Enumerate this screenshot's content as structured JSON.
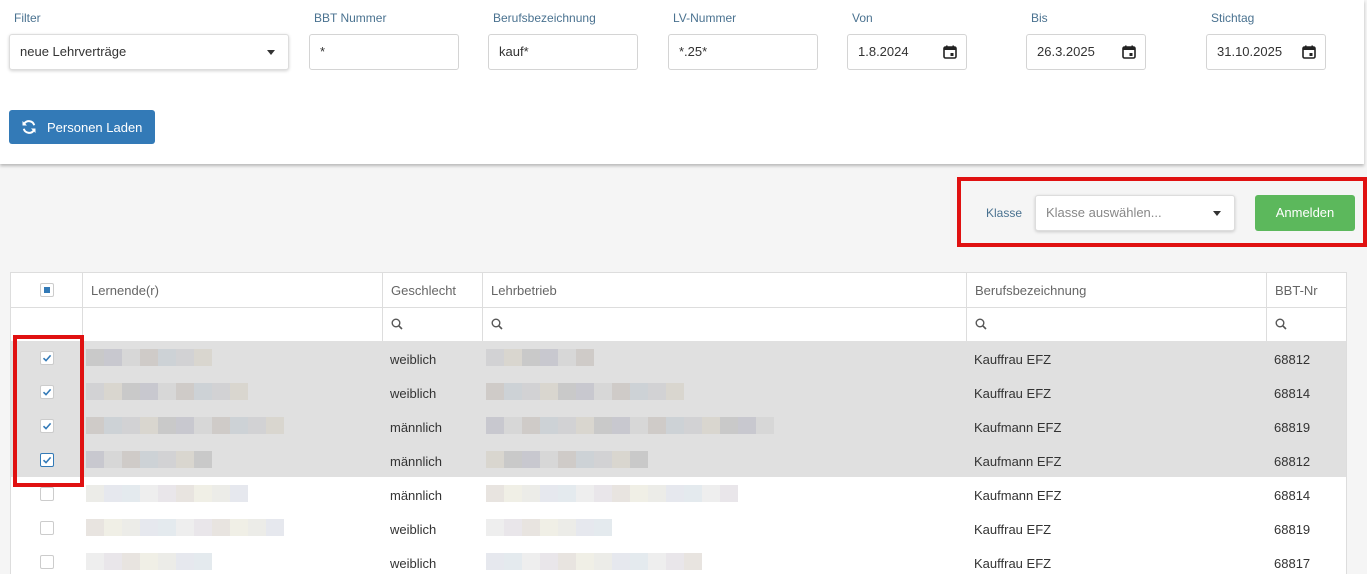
{
  "filters": {
    "filter": {
      "label": "Filter",
      "value": "neue Lehrverträge"
    },
    "bbt": {
      "label": "BBT Nummer",
      "value": "*"
    },
    "beruf": {
      "label": "Berufsbezeichnung",
      "value": "kauf*"
    },
    "lv": {
      "label": "LV-Nummer",
      "value": "*.25*"
    },
    "von": {
      "label": "Von",
      "value": "1.8.2024"
    },
    "bis": {
      "label": "Bis",
      "value": "26.3.2025"
    },
    "stichtag": {
      "label": "Stichtag",
      "value": "31.10.2025"
    },
    "load_button": "Personen Laden"
  },
  "toolbar": {
    "klasse_label": "Klasse",
    "klasse_placeholder": "Klasse auswählen...",
    "anmelden_button": "Anmelden"
  },
  "table": {
    "columns": [
      "Lernende(r)",
      "Geschlecht",
      "Lehrbetrieb",
      "Berufsbezeichnung",
      "BBT-Nr"
    ],
    "rows": [
      {
        "selected": true,
        "geschlecht": "weiblich",
        "beruf": "Kauffrau EFZ",
        "bbt": "68812"
      },
      {
        "selected": true,
        "geschlecht": "weiblich",
        "beruf": "Kauffrau EFZ",
        "bbt": "68814"
      },
      {
        "selected": true,
        "geschlecht": "männlich",
        "beruf": "Kaufmann EFZ",
        "bbt": "68819"
      },
      {
        "selected": true,
        "geschlecht": "männlich",
        "beruf": "Kaufmann EFZ",
        "bbt": "68812"
      },
      {
        "selected": false,
        "geschlecht": "männlich",
        "beruf": "Kaufmann EFZ",
        "bbt": "68814"
      },
      {
        "selected": false,
        "geschlecht": "weiblich",
        "beruf": "Kauffrau EFZ",
        "bbt": "68819"
      },
      {
        "selected": false,
        "geschlecht": "weiblich",
        "beruf": "Kauffrau EFZ",
        "bbt": "68817"
      }
    ]
  },
  "colors": {
    "primary": "#337ab7",
    "success": "#5cb85c",
    "highlight": "#e01111",
    "selected_row": "#e0e0e0"
  }
}
